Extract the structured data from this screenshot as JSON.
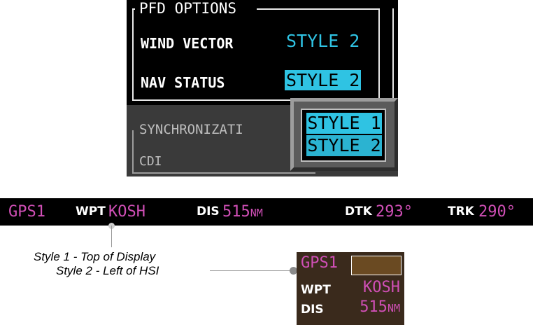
{
  "pfd_options": {
    "title": "PFD OPTIONS",
    "rows": [
      {
        "label": "WIND VECTOR",
        "value": "STYLE 2"
      },
      {
        "label": "NAV STATUS",
        "value": "STYLE 2"
      }
    ],
    "sync_title": "SYNCHRONIZATI",
    "cdi_label": "CDI",
    "popup_options": [
      "STYLE 1",
      "STYLE 2"
    ],
    "selected_option": "STYLE 1",
    "colors": {
      "accent": "#2fc3e3",
      "magenta": "#d04fb6"
    }
  },
  "nav_status": {
    "source": "GPS1",
    "wpt_label": "WPT",
    "wpt_value": "KOSH",
    "dis_label": "DIS",
    "dis_value": "515",
    "dis_unit": "NM",
    "dtk_label": "DTK",
    "dtk_value": "293°",
    "trk_label": "TRK",
    "trk_value": "290°"
  },
  "callouts": {
    "style1": "Style 1 - Top of Display",
    "style2": "Style 2 - Left of HSI"
  },
  "hsi_panel": {
    "source": "GPS1",
    "wpt_label": "WPT",
    "wpt_value": "KOSH",
    "dis_label": "DIS",
    "dis_value": "515",
    "dis_unit": "NM"
  }
}
